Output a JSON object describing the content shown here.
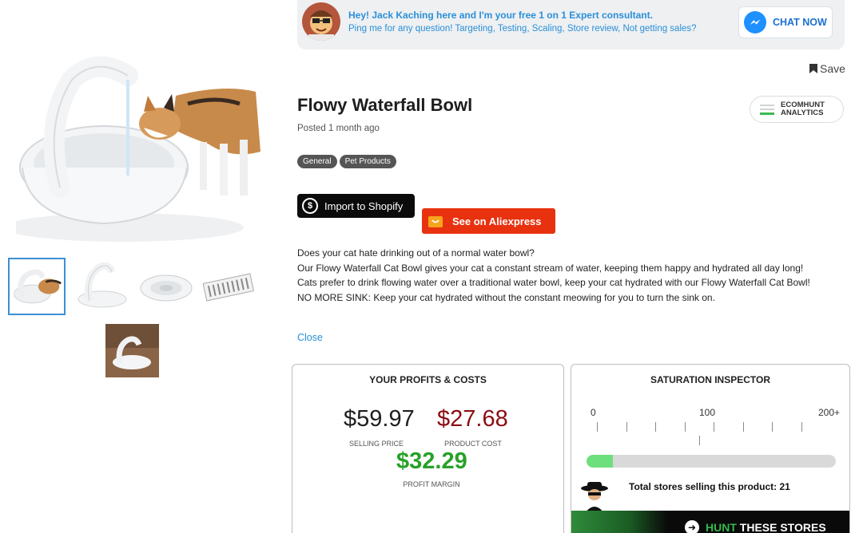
{
  "banner": {
    "line1": "Hey! Jack Kaching here and I'm your free 1 on 1 Expert consultant.",
    "line2": "Ping me for any question! Targeting, Testing, Scaling, Store review, Not getting sales?",
    "chat_label": "CHAT NOW"
  },
  "save_label": "Save",
  "product": {
    "title": "Flowy Waterfall Bowl",
    "posted": "Posted 1 month ago",
    "tags": [
      "General",
      "Pet Products"
    ]
  },
  "analytics": {
    "line1": "ECOMHUNT",
    "line2": "ANALYTICS"
  },
  "buttons": {
    "import": "Import to Shopify",
    "aliexpress": "See on Aliexpress",
    "close": "Close"
  },
  "description": [
    "Does your cat hate drinking out of a normal water bowl?",
    "Our Flowy Waterfall Cat Bowl gives your cat a constant stream of water, keeping them happy and hydrated all day long!",
    "Cats prefer to drink flowing water over a traditional water bowl, keep your cat hydrated with our Flowy Waterfall Cat Bowl!",
    "NO MORE SINK: Keep your cat hydrated without the constant meowing for you to turn the sink on."
  ],
  "profits": {
    "title": "YOUR PROFITS & COSTS",
    "selling_price": "$59.97",
    "selling_label": "SELLING PRICE",
    "product_cost": "$27.68",
    "cost_label": "PRODUCT COST",
    "profit_margin": "$32.29",
    "profit_label": "PROFIT MARGIN"
  },
  "saturation": {
    "title": "SATURATION INSPECTOR",
    "scale": [
      "0",
      "100",
      "200+"
    ],
    "stores": 21,
    "scale_max": 200,
    "fill_fraction": 0.105,
    "total_text": "Total stores selling this product: 21",
    "hunt_word": "HUNT",
    "hunt_rest": " THESE STORES"
  },
  "colors": {
    "accent_blue": "#2a8fd8",
    "cost_red": "#8a0d12",
    "profit_green": "#28a129",
    "aliexpress_red": "#e8320f",
    "saturation_green": "#6ddf7d"
  },
  "icons": {
    "chat": "messenger-icon",
    "save": "bookmark-icon",
    "import": "shopify-dollar-icon",
    "aliexpress": "aliexpress-bag-icon",
    "hunt": "arrow-right-circle-icon"
  }
}
